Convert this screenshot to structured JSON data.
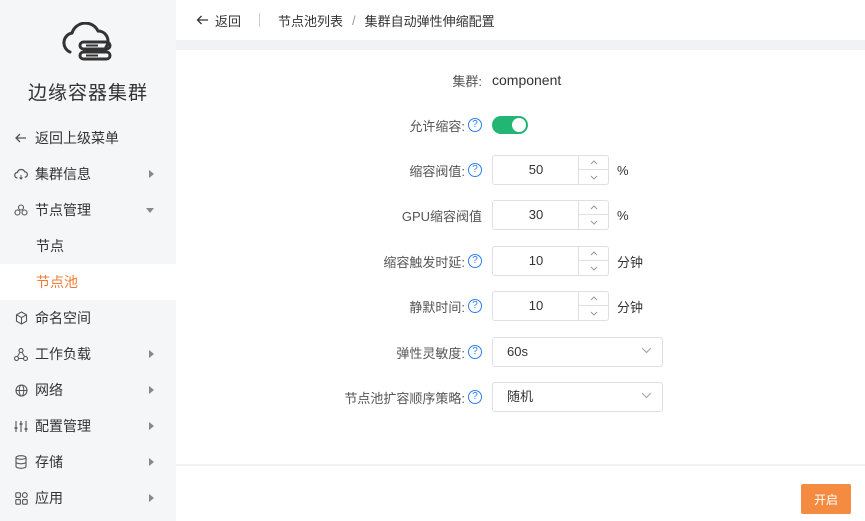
{
  "sidebar": {
    "cluster_title": "边缘容器集群",
    "back_menu": "返回上级菜单",
    "items": [
      {
        "label": "集群信息",
        "icon": "cloud-icon"
      },
      {
        "label": "节点管理",
        "icon": "nodes-icon"
      },
      {
        "label": "节点"
      },
      {
        "label": "节点池"
      },
      {
        "label": "命名空间",
        "icon": "namespace-icon"
      },
      {
        "label": "工作负载",
        "icon": "workload-icon"
      },
      {
        "label": "网络",
        "icon": "globe-icon"
      },
      {
        "label": "配置管理",
        "icon": "sliders-icon"
      },
      {
        "label": "存储",
        "icon": "database-icon"
      },
      {
        "label": "应用",
        "icon": "apps-icon"
      }
    ]
  },
  "header": {
    "back": "返回",
    "crumb_list": "节点池列表",
    "crumb_current": "集群自动弹性伸缩配置"
  },
  "form": {
    "cluster_label": "集群:",
    "cluster_value": "component",
    "allow_scale_label": "允许缩容:",
    "allow_scale_on": true,
    "threshold_label": "缩容阀值:",
    "threshold_value": "50",
    "gpu_threshold_label": "GPU缩容阀值",
    "gpu_threshold_value": "30",
    "percent_unit": "%",
    "delay_label": "缩容触发时延:",
    "delay_value": "10",
    "quiet_label": "静默时间:",
    "quiet_value": "10",
    "minute_unit": "分钟",
    "sensitivity_label": "弹性灵敏度:",
    "sensitivity_value": "60s",
    "strategy_label": "节点池扩容顺序策略:",
    "strategy_value": "随机",
    "help_glyph": "?"
  },
  "footer": {
    "open_button": "开启"
  },
  "colors": {
    "accent": "#ef7d35",
    "button": "#f58b41",
    "toggle_on": "#22b573",
    "help": "#2d7ef0"
  }
}
